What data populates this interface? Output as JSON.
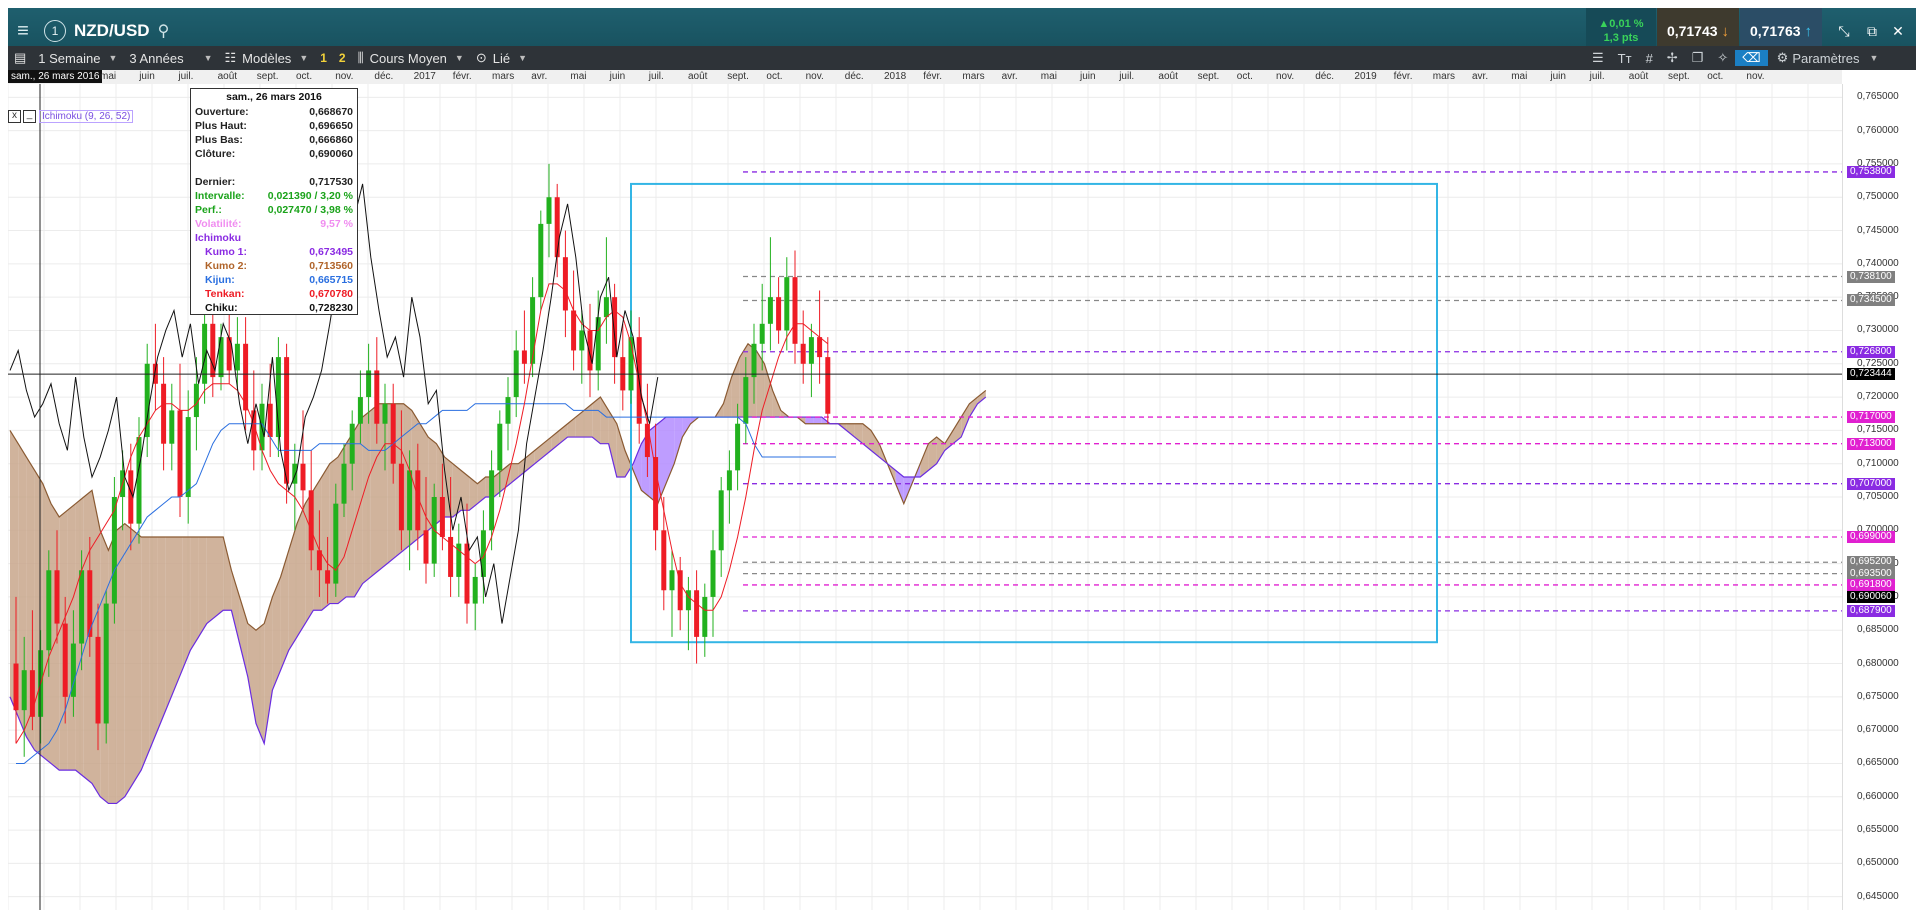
{
  "header": {
    "symbol": "NZD/USD",
    "info_badge": "1",
    "change_pct": "▲0,01 %",
    "change_pts": "1,3 pts",
    "bid": "0,71743",
    "ask": "0,71763"
  },
  "toolbar": {
    "period": "1 Semaine",
    "range": "3 Années",
    "models": "Modèles",
    "slot1": "1",
    "slot2": "2",
    "price_type": "Cours Moyen",
    "linked": "Lié",
    "settings": "Paramètres"
  },
  "time_axis": {
    "selected_date": "sam., 26 mars 2016",
    "months": [
      "mai",
      "juin",
      "juil.",
      "août",
      "sept.",
      "oct.",
      "nov.",
      "déc.",
      "2017",
      "févr.",
      "mars",
      "avr.",
      "mai",
      "juin",
      "juil.",
      "août",
      "sept.",
      "oct.",
      "nov.",
      "déc.",
      "2018",
      "févr.",
      "mars",
      "avr.",
      "mai",
      "juin",
      "juil.",
      "août",
      "sept.",
      "oct.",
      "nov.",
      "déc.",
      "2019",
      "févr.",
      "mars",
      "avr.",
      "mai",
      "juin",
      "juil.",
      "août",
      "sept.",
      "oct.",
      "nov."
    ]
  },
  "indicator_legend": {
    "close": "x",
    "minimize": "_",
    "label": "Ichimoku (9, 26, 52)"
  },
  "info_box": {
    "title": "sam., 26 mars 2016",
    "open_label": "Ouverture:",
    "open": "0,668670",
    "high_label": "Plus Haut:",
    "high": "0,696650",
    "low_label": "Plus Bas:",
    "low": "0,666860",
    "close_label": "Clôture:",
    "close": "0,690060",
    "last_label": "Dernier:",
    "last": "0,717530",
    "interval_label": "Intervalle:",
    "interval": "0,021390 / 3,20 %",
    "perf_label": "Perf.:",
    "perf": "0,027470 / 3,98 %",
    "vol_label": "Volatilité:",
    "vol": "9,57 %",
    "ichimoku_label": "Ichimoku",
    "kumo1_label": "Kumo 1:",
    "kumo1": "0,673495",
    "kumo2_label": "Kumo 2:",
    "kumo2": "0,713560",
    "kijun_label": "Kijun:",
    "kijun": "0,665715",
    "tenkan_label": "Tenkan:",
    "tenkan": "0,670780",
    "chiku_label": "Chiku:",
    "chiku": "0,728230"
  },
  "price_axis": {
    "labels": [
      "0,765000",
      "0,760000",
      "0,755000",
      "0,750000",
      "0,745000",
      "0,740000",
      "0,735000",
      "0,730000",
      "0,725000",
      "0,720000",
      "0,715000",
      "0,710000",
      "0,705000",
      "0,700000",
      "0,695000",
      "0,690000",
      "0,685000",
      "0,680000",
      "0,675000",
      "0,670000",
      "0,665000",
      "0,660000",
      "0,655000",
      "0,650000",
      "0,645000"
    ],
    "tags": [
      {
        "text": "0,753800",
        "color": "#8a2be2"
      },
      {
        "text": "0,738100",
        "color": "#808080"
      },
      {
        "text": "0,734500",
        "color": "#808080"
      },
      {
        "text": "0,726800",
        "color": "#8a2be2"
      },
      {
        "text": "0,723444",
        "color": "#000000"
      },
      {
        "text": "0,717000",
        "color": "#e020d0"
      },
      {
        "text": "0,713000",
        "color": "#e020d0"
      },
      {
        "text": "0,707000",
        "color": "#8a2be2"
      },
      {
        "text": "0,699000",
        "color": "#e020d0"
      },
      {
        "text": "0,695200",
        "color": "#808080"
      },
      {
        "text": "0,693500",
        "color": "#808080"
      },
      {
        "text": "0,691800",
        "color": "#e020d0"
      },
      {
        "text": "0,690060",
        "color": "#000000"
      },
      {
        "text": "0,687900",
        "color": "#8a2be2"
      }
    ]
  },
  "chart_data": {
    "type": "candlestick",
    "instrument": "NZD/USD",
    "interval": "1 Semaine",
    "ylim": [
      0.643,
      0.767
    ],
    "indicator": "Ichimoku (9, 26, 52)",
    "candles": [
      [
        0.68,
        0.69,
        0.668,
        0.673
      ],
      [
        0.673,
        0.684,
        0.666,
        0.679
      ],
      [
        0.679,
        0.688,
        0.67,
        0.672
      ],
      [
        0.672,
        0.685,
        0.668,
        0.682
      ],
      [
        0.682,
        0.697,
        0.678,
        0.694
      ],
      [
        0.694,
        0.7,
        0.683,
        0.686
      ],
      [
        0.686,
        0.69,
        0.671,
        0.675
      ],
      [
        0.675,
        0.688,
        0.672,
        0.683
      ],
      [
        0.683,
        0.697,
        0.679,
        0.694
      ],
      [
        0.694,
        0.699,
        0.681,
        0.684
      ],
      [
        0.684,
        0.689,
        0.667,
        0.671
      ],
      [
        0.671,
        0.691,
        0.668,
        0.689
      ],
      [
        0.689,
        0.708,
        0.686,
        0.705
      ],
      [
        0.705,
        0.712,
        0.7,
        0.709
      ],
      [
        0.709,
        0.713,
        0.697,
        0.701
      ],
      [
        0.701,
        0.717,
        0.698,
        0.714
      ],
      [
        0.714,
        0.728,
        0.711,
        0.725
      ],
      [
        0.725,
        0.731,
        0.718,
        0.722
      ],
      [
        0.722,
        0.726,
        0.709,
        0.713
      ],
      [
        0.713,
        0.722,
        0.709,
        0.718
      ],
      [
        0.718,
        0.725,
        0.702,
        0.705
      ],
      [
        0.705,
        0.721,
        0.701,
        0.717
      ],
      [
        0.717,
        0.726,
        0.712,
        0.722
      ],
      [
        0.722,
        0.734,
        0.719,
        0.731
      ],
      [
        0.731,
        0.734,
        0.72,
        0.723
      ],
      [
        0.723,
        0.731,
        0.721,
        0.729
      ],
      [
        0.729,
        0.733,
        0.722,
        0.724
      ],
      [
        0.724,
        0.732,
        0.721,
        0.728
      ],
      [
        0.728,
        0.732,
        0.715,
        0.718
      ],
      [
        0.718,
        0.724,
        0.709,
        0.712
      ],
      [
        0.712,
        0.722,
        0.709,
        0.719
      ],
      [
        0.719,
        0.725,
        0.711,
        0.714
      ],
      [
        0.714,
        0.729,
        0.711,
        0.726
      ],
      [
        0.726,
        0.728,
        0.704,
        0.707
      ],
      [
        0.707,
        0.713,
        0.7,
        0.71
      ],
      [
        0.71,
        0.718,
        0.703,
        0.706
      ],
      [
        0.706,
        0.712,
        0.694,
        0.697
      ],
      [
        0.697,
        0.703,
        0.69,
        0.694
      ],
      [
        0.694,
        0.699,
        0.689,
        0.692
      ],
      [
        0.692,
        0.707,
        0.69,
        0.704
      ],
      [
        0.704,
        0.713,
        0.702,
        0.71
      ],
      [
        0.71,
        0.718,
        0.706,
        0.716
      ],
      [
        0.716,
        0.724,
        0.713,
        0.72
      ],
      [
        0.72,
        0.728,
        0.716,
        0.724
      ],
      [
        0.724,
        0.729,
        0.713,
        0.716
      ],
      [
        0.716,
        0.722,
        0.709,
        0.719
      ],
      [
        0.719,
        0.722,
        0.707,
        0.71
      ],
      [
        0.71,
        0.718,
        0.697,
        0.7
      ],
      [
        0.7,
        0.712,
        0.694,
        0.709
      ],
      [
        0.709,
        0.713,
        0.697,
        0.7
      ],
      [
        0.7,
        0.708,
        0.692,
        0.695
      ],
      [
        0.695,
        0.707,
        0.693,
        0.705
      ],
      [
        0.705,
        0.71,
        0.697,
        0.699
      ],
      [
        0.699,
        0.708,
        0.69,
        0.693
      ],
      [
        0.693,
        0.701,
        0.69,
        0.698
      ],
      [
        0.698,
        0.704,
        0.686,
        0.689
      ],
      [
        0.689,
        0.695,
        0.685,
        0.693
      ],
      [
        0.693,
        0.703,
        0.689,
        0.7
      ],
      [
        0.7,
        0.712,
        0.697,
        0.709
      ],
      [
        0.709,
        0.718,
        0.705,
        0.716
      ],
      [
        0.716,
        0.723,
        0.712,
        0.72
      ],
      [
        0.72,
        0.73,
        0.717,
        0.727
      ],
      [
        0.727,
        0.733,
        0.722,
        0.725
      ],
      [
        0.725,
        0.738,
        0.723,
        0.735
      ],
      [
        0.735,
        0.748,
        0.733,
        0.746
      ],
      [
        0.746,
        0.755,
        0.741,
        0.75
      ],
      [
        0.75,
        0.752,
        0.738,
        0.741
      ],
      [
        0.741,
        0.745,
        0.729,
        0.733
      ],
      [
        0.733,
        0.739,
        0.724,
        0.727
      ],
      [
        0.727,
        0.733,
        0.722,
        0.73
      ],
      [
        0.73,
        0.734,
        0.72,
        0.724
      ],
      [
        0.724,
        0.736,
        0.721,
        0.732
      ],
      [
        0.732,
        0.744,
        0.728,
        0.735
      ],
      [
        0.735,
        0.737,
        0.722,
        0.726
      ],
      [
        0.726,
        0.731,
        0.718,
        0.721
      ],
      [
        0.721,
        0.733,
        0.719,
        0.729
      ],
      [
        0.729,
        0.732,
        0.713,
        0.716
      ],
      [
        0.716,
        0.722,
        0.708,
        0.711
      ],
      [
        0.711,
        0.716,
        0.697,
        0.7
      ],
      [
        0.7,
        0.705,
        0.688,
        0.691
      ],
      [
        0.691,
        0.697,
        0.684,
        0.694
      ],
      [
        0.694,
        0.696,
        0.685,
        0.688
      ],
      [
        0.688,
        0.693,
        0.682,
        0.691
      ],
      [
        0.691,
        0.694,
        0.68,
        0.684
      ],
      [
        0.684,
        0.692,
        0.681,
        0.69
      ],
      [
        0.69,
        0.7,
        0.684,
        0.697
      ],
      [
        0.697,
        0.708,
        0.693,
        0.706
      ],
      [
        0.706,
        0.712,
        0.701,
        0.709
      ],
      [
        0.709,
        0.719,
        0.706,
        0.716
      ],
      [
        0.716,
        0.726,
        0.713,
        0.723
      ],
      [
        0.723,
        0.731,
        0.719,
        0.728
      ],
      [
        0.728,
        0.737,
        0.724,
        0.731
      ],
      [
        0.731,
        0.744,
        0.727,
        0.735
      ],
      [
        0.735,
        0.738,
        0.728,
        0.73
      ],
      [
        0.73,
        0.741,
        0.727,
        0.738
      ],
      [
        0.738,
        0.742,
        0.725,
        0.728
      ],
      [
        0.728,
        0.733,
        0.722,
        0.725
      ],
      [
        0.725,
        0.731,
        0.72,
        0.729
      ],
      [
        0.729,
        0.736,
        0.722,
        0.726
      ],
      [
        0.726,
        0.729,
        0.716,
        0.7175
      ]
    ],
    "cloud_top": [
      0.715,
      0.713,
      0.711,
      0.709,
      0.707,
      0.704,
      0.702,
      0.703,
      0.704,
      0.705,
      0.706,
      0.7,
      0.697,
      0.7,
      0.701,
      0.7,
      0.699,
      0.699,
      0.699,
      0.699,
      0.699,
      0.699,
      0.699,
      0.699,
      0.699,
      0.699,
      0.699,
      0.694,
      0.69,
      0.686,
      0.685,
      0.686,
      0.69,
      0.693,
      0.697,
      0.701,
      0.704,
      0.706,
      0.708,
      0.71,
      0.711,
      0.713,
      0.715,
      0.717,
      0.718,
      0.719,
      0.719,
      0.719,
      0.719,
      0.718,
      0.716,
      0.714,
      0.713,
      0.711,
      0.71,
      0.709,
      0.708,
      0.707,
      0.708,
      0.708,
      0.709,
      0.71,
      0.71,
      0.711,
      0.712,
      0.713,
      0.714,
      0.715,
      0.716,
      0.717,
      0.718,
      0.719,
      0.72,
      0.718,
      0.716,
      0.712,
      0.709,
      0.706,
      0.705,
      0.704,
      0.707,
      0.71,
      0.714,
      0.716,
      0.717,
      0.717,
      0.717,
      0.719,
      0.723,
      0.726,
      0.728,
      0.727,
      0.725,
      0.721,
      0.718,
      0.717,
      0.717,
      0.716,
      0.716,
      0.716,
      0.716,
      0.716,
      0.716,
      0.716,
      0.716,
      0.715,
      0.713,
      0.71,
      0.707,
      0.704,
      0.707,
      0.71,
      0.713,
      0.714,
      0.713,
      0.715,
      0.717,
      0.719,
      0.72,
      0.721
    ],
    "cloud_bottom": [
      0.675,
      0.672,
      0.669,
      0.667,
      0.666,
      0.665,
      0.664,
      0.664,
      0.664,
      0.663,
      0.662,
      0.66,
      0.659,
      0.659,
      0.66,
      0.662,
      0.664,
      0.667,
      0.67,
      0.673,
      0.676,
      0.679,
      0.682,
      0.684,
      0.686,
      0.687,
      0.688,
      0.688,
      0.683,
      0.678,
      0.671,
      0.668,
      0.676,
      0.679,
      0.682,
      0.684,
      0.686,
      0.688,
      0.688,
      0.689,
      0.689,
      0.69,
      0.69,
      0.692,
      0.693,
      0.694,
      0.695,
      0.696,
      0.697,
      0.698,
      0.699,
      0.7,
      0.701,
      0.702,
      0.702,
      0.703,
      0.703,
      0.704,
      0.705,
      0.705,
      0.706,
      0.707,
      0.708,
      0.709,
      0.71,
      0.711,
      0.712,
      0.713,
      0.714,
      0.714,
      0.714,
      0.714,
      0.713,
      0.713,
      0.708,
      0.708,
      0.71,
      0.713,
      0.715,
      0.716,
      0.717,
      0.717,
      0.717,
      0.717,
      0.717,
      0.717,
      0.717,
      0.717,
      0.717,
      0.717,
      0.717,
      0.717,
      0.717,
      0.717,
      0.717,
      0.717,
      0.717,
      0.717,
      0.717,
      0.717,
      0.716,
      0.716,
      0.715,
      0.714,
      0.713,
      0.712,
      0.711,
      0.71,
      0.709,
      0.708,
      0.708,
      0.708,
      0.709,
      0.71,
      0.712,
      0.713,
      0.714,
      0.717,
      0.719,
      0.72
    ],
    "tenkan": [
      0.668,
      0.67,
      0.673,
      0.677,
      0.681,
      0.684,
      0.687,
      0.69,
      0.694,
      0.697,
      0.699,
      0.701,
      0.703,
      0.707,
      0.711,
      0.714,
      0.716,
      0.718,
      0.719,
      0.719,
      0.718,
      0.718,
      0.719,
      0.721,
      0.722,
      0.722,
      0.722,
      0.721,
      0.719,
      0.716,
      0.712,
      0.709,
      0.707,
      0.706,
      0.705,
      0.703,
      0.7,
      0.697,
      0.695,
      0.694,
      0.696,
      0.7,
      0.704,
      0.708,
      0.711,
      0.713,
      0.713,
      0.712,
      0.709,
      0.705,
      0.702,
      0.7,
      0.699,
      0.698,
      0.697,
      0.696,
      0.695,
      0.696,
      0.699,
      0.703,
      0.708,
      0.713,
      0.719,
      0.726,
      0.733,
      0.737,
      0.737,
      0.736,
      0.733,
      0.731,
      0.73,
      0.73,
      0.732,
      0.733,
      0.732,
      0.728,
      0.722,
      0.716,
      0.709,
      0.703,
      0.697,
      0.692,
      0.69,
      0.689,
      0.688,
      0.688,
      0.69,
      0.694,
      0.699,
      0.705,
      0.712,
      0.718,
      0.722,
      0.726,
      0.729,
      0.731,
      0.731,
      0.73,
      0.729,
      0.728
    ],
    "kijun": [
      0.665,
      0.665,
      0.666,
      0.667,
      0.668,
      0.67,
      0.673,
      0.677,
      0.681,
      0.685,
      0.688,
      0.691,
      0.694,
      0.696,
      0.698,
      0.7,
      0.702,
      0.703,
      0.704,
      0.705,
      0.705,
      0.706,
      0.707,
      0.71,
      0.713,
      0.715,
      0.716,
      0.716,
      0.716,
      0.716,
      0.716,
      0.714,
      0.712,
      0.712,
      0.712,
      0.712,
      0.712,
      0.713,
      0.713,
      0.713,
      0.713,
      0.713,
      0.713,
      0.712,
      0.712,
      0.712,
      0.713,
      0.714,
      0.715,
      0.716,
      0.716,
      0.717,
      0.718,
      0.718,
      0.718,
      0.718,
      0.719,
      0.719,
      0.719,
      0.719,
      0.719,
      0.719,
      0.719,
      0.719,
      0.719,
      0.719,
      0.719,
      0.719,
      0.718,
      0.718,
      0.718,
      0.718,
      0.717,
      0.717,
      0.717,
      0.717,
      0.717,
      0.717,
      0.717,
      0.717,
      0.717,
      0.717,
      0.717,
      0.717,
      0.717,
      0.717,
      0.717,
      0.717,
      0.717,
      0.716,
      0.713,
      0.711,
      0.711,
      0.711,
      0.711,
      0.711,
      0.711,
      0.711,
      0.711,
      0.711,
      0.711
    ],
    "chikou": [
      0.724,
      0.727,
      0.721,
      0.717,
      0.719,
      0.722,
      0.716,
      0.712,
      0.723,
      0.714,
      0.708,
      0.711,
      0.715,
      0.72,
      0.708,
      0.705,
      0.711,
      0.719,
      0.726,
      0.73,
      0.733,
      0.726,
      0.731,
      0.722,
      0.727,
      0.724,
      0.731,
      0.728,
      0.719,
      0.713,
      0.719,
      0.714,
      0.726,
      0.712,
      0.706,
      0.709,
      0.717,
      0.72,
      0.724,
      0.731,
      0.739,
      0.733,
      0.747,
      0.752,
      0.741,
      0.733,
      0.726,
      0.729,
      0.723,
      0.735,
      0.729,
      0.719,
      0.721,
      0.709,
      0.7,
      0.705,
      0.697,
      0.699,
      0.69,
      0.695,
      0.686,
      0.693,
      0.7,
      0.713,
      0.72,
      0.727,
      0.735,
      0.744,
      0.749,
      0.741,
      0.73,
      0.725,
      0.735,
      0.738,
      0.726,
      0.733,
      0.729,
      0.72,
      0.716,
      0.723
    ],
    "horizontal_lines": [
      {
        "price": 0.7538,
        "color": "#8a2be2"
      },
      {
        "price": 0.7381,
        "color": "#888888"
      },
      {
        "price": 0.7345,
        "color": "#888888"
      },
      {
        "price": 0.7268,
        "color": "#8a2be2"
      },
      {
        "price": 0.717,
        "color": "#e020d0"
      },
      {
        "price": 0.713,
        "color": "#e020d0"
      },
      {
        "price": 0.707,
        "color": "#8a2be2"
      },
      {
        "price": 0.699,
        "color": "#e020d0"
      },
      {
        "price": 0.6952,
        "color": "#888888"
      },
      {
        "price": 0.6935,
        "color": "#888888"
      },
      {
        "price": 0.6918,
        "color": "#e020d0"
      },
      {
        "price": 0.6879,
        "color": "#8a2be2"
      }
    ],
    "current_price": 0.723444,
    "colors": {
      "up": "#22b11e",
      "down": "#ee1c25",
      "cloud_bull": "#b38cff",
      "cloud_bear": "#c8a68b",
      "tenkan": "#ee1c25",
      "kijun": "#2a6fe0",
      "chikou": "#111111",
      "box": "#33b5e5"
    }
  }
}
